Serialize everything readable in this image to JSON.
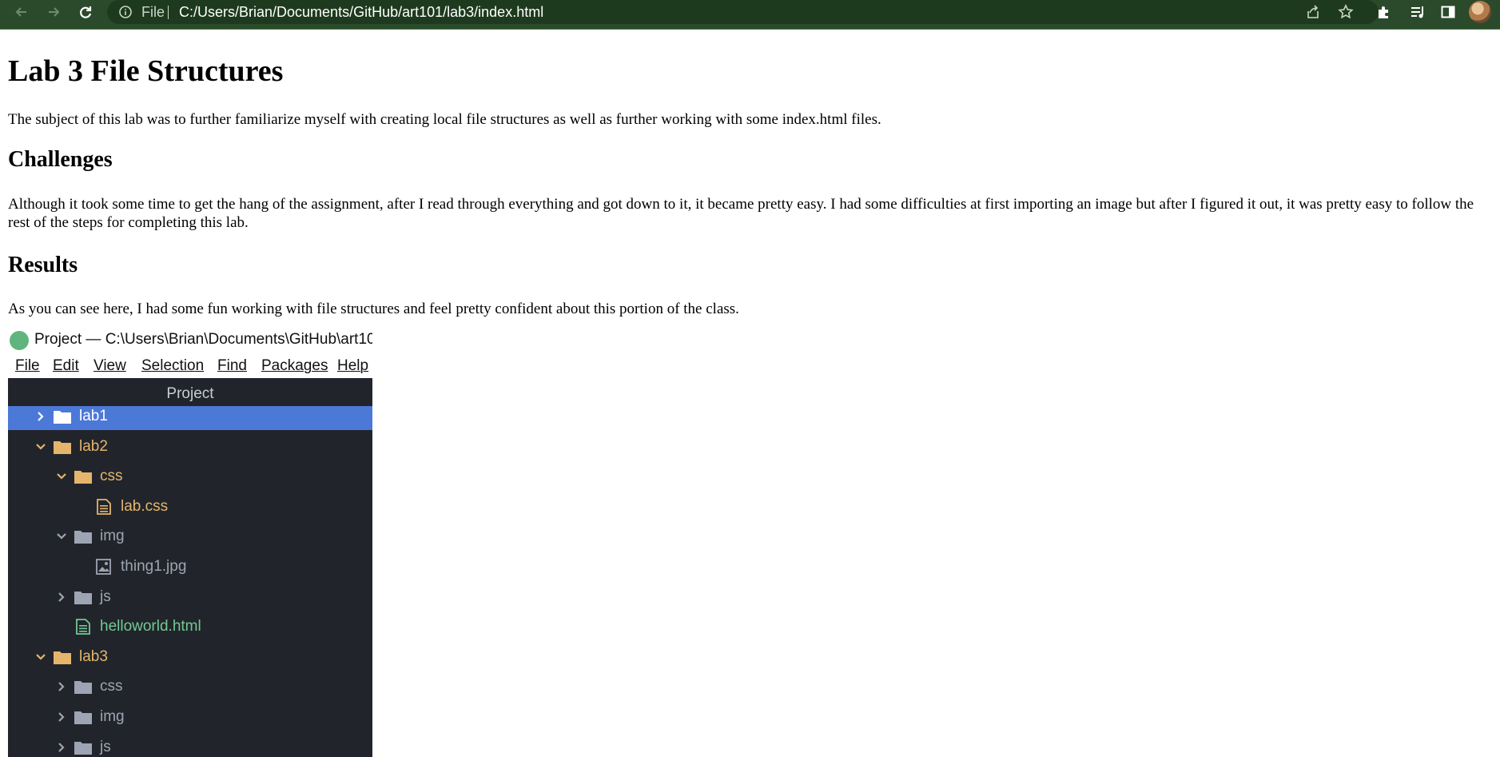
{
  "browser": {
    "scheme_label": "File",
    "url": "C:/Users/Brian/Documents/GitHub/art101/lab3/index.html",
    "icons": [
      "back-arrow-icon",
      "forward-arrow-icon",
      "reload-icon",
      "info-icon",
      "share-icon",
      "bookmark-star-icon",
      "extensions-puzzle-icon",
      "media-queue-icon",
      "side-panel-icon",
      "profile-avatar"
    ]
  },
  "page": {
    "title": "Lab 3 File Structures",
    "intro": "The subject of this lab was to further familiarize myself with creating local file structures as well as further working with some index.html files.",
    "challenges_heading": "Challenges",
    "challenges_text": "Although it took some time to get the hang of the assignment, after I read through everything and got down to it, it became pretty easy. I had some difficulties at first importing an image but after I figured it out, it was pretty easy to follow the rest of the steps for completing this lab.",
    "results_heading": "Results",
    "results_text": "As you can see here, I had some fun working with file structures and feel pretty confident about this portion of the class."
  },
  "screenshot": {
    "window_title": "Project — C:\\Users\\Brian\\Documents\\GitHub\\art10",
    "menu": [
      "File",
      "Edit",
      "View",
      "Selection",
      "Find",
      "Packages",
      "Help"
    ],
    "panel_title": "Project",
    "tree": [
      {
        "label": "lab1",
        "type": "folder",
        "expanded": false,
        "selected": true
      },
      {
        "label": "lab2",
        "type": "folder",
        "expanded": true
      },
      {
        "label": "css",
        "type": "folder",
        "expanded": true
      },
      {
        "label": "lab.css",
        "type": "file"
      },
      {
        "label": "img",
        "type": "folder",
        "expanded": true
      },
      {
        "label": "thing1.jpg",
        "type": "image"
      },
      {
        "label": "js",
        "type": "folder",
        "expanded": false
      },
      {
        "label": "helloworld.html",
        "type": "file"
      },
      {
        "label": "lab3",
        "type": "folder",
        "expanded": true
      },
      {
        "label": "css",
        "type": "folder",
        "expanded": false
      },
      {
        "label": "img",
        "type": "folder",
        "expanded": false
      },
      {
        "label": "js",
        "type": "folder",
        "expanded": false
      }
    ],
    "colors": {
      "selected_bg": "#4c78d8",
      "modified_orange": "#e5b56d",
      "added_green": "#73c991",
      "muted_gray": "#9da5b4"
    }
  }
}
